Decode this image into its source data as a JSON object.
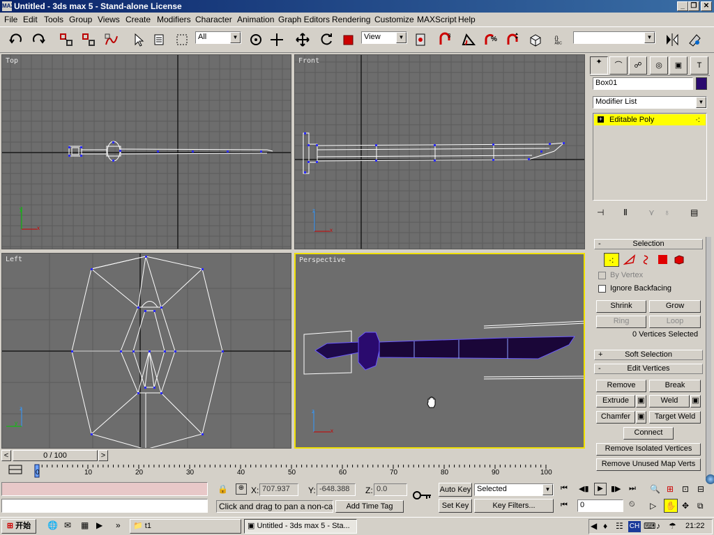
{
  "window": {
    "title": "Untitled - 3ds max 5 - Stand-alone License",
    "app_icon": "3ds-max-icon"
  },
  "menu": [
    "File",
    "Edit",
    "Tools",
    "Group",
    "Views",
    "Create",
    "Modifiers",
    "Character",
    "Animation",
    "Graph Editors",
    "Rendering",
    "Customize",
    "MAXScript",
    "Help"
  ],
  "toolbar": {
    "selection_filter": "All",
    "ref_coord": "View",
    "named_selection": ""
  },
  "viewports": {
    "top": "Top",
    "front": "Front",
    "left": "Left",
    "perspective": "Perspective"
  },
  "command_panel": {
    "object_name": "Box01",
    "object_color": "#2a0a6e",
    "modifier_list": "Modifier List",
    "stack_item": "Editable Poly",
    "selection": {
      "title": "Selection",
      "by_vertex": "By Vertex",
      "ignore_backfacing": "Ignore Backfacing",
      "shrink": "Shrink",
      "grow": "Grow",
      "ring": "Ring",
      "loop": "Loop",
      "status": "0 Vertices Selected"
    },
    "soft_selection": "Soft Selection",
    "edit_vertices": {
      "title": "Edit Vertices",
      "remove": "Remove",
      "break": "Break",
      "extrude": "Extrude",
      "weld": "Weld",
      "chamfer": "Chamfer",
      "target_weld": "Target Weld",
      "connect": "Connect",
      "remove_isolated": "Remove Isolated Vertices",
      "remove_unused": "Remove Unused Map Verts"
    }
  },
  "timeline": {
    "slider": "0 / 100",
    "ticks": [
      "0",
      "10",
      "20",
      "30",
      "40",
      "50",
      "60",
      "70",
      "80",
      "90",
      "100"
    ]
  },
  "status": {
    "x_label": "X:",
    "x": "707.937",
    "y_label": "Y:",
    "y": "-648.388",
    "z_label": "Z:",
    "z": "0.0",
    "prompt": "Click and drag to pan a non-camera",
    "add_time_tag": "Add Time Tag",
    "auto_key": "Auto Key",
    "set_key": "Set Key",
    "key_mode": "Selected",
    "key_filters": "Key Filters...",
    "frame": "0"
  },
  "taskbar": {
    "start": "开始",
    "folder_task": "t1",
    "max_task": "Untitled - 3ds max 5 - Sta...",
    "lang": "CH",
    "clock": "21:22"
  }
}
